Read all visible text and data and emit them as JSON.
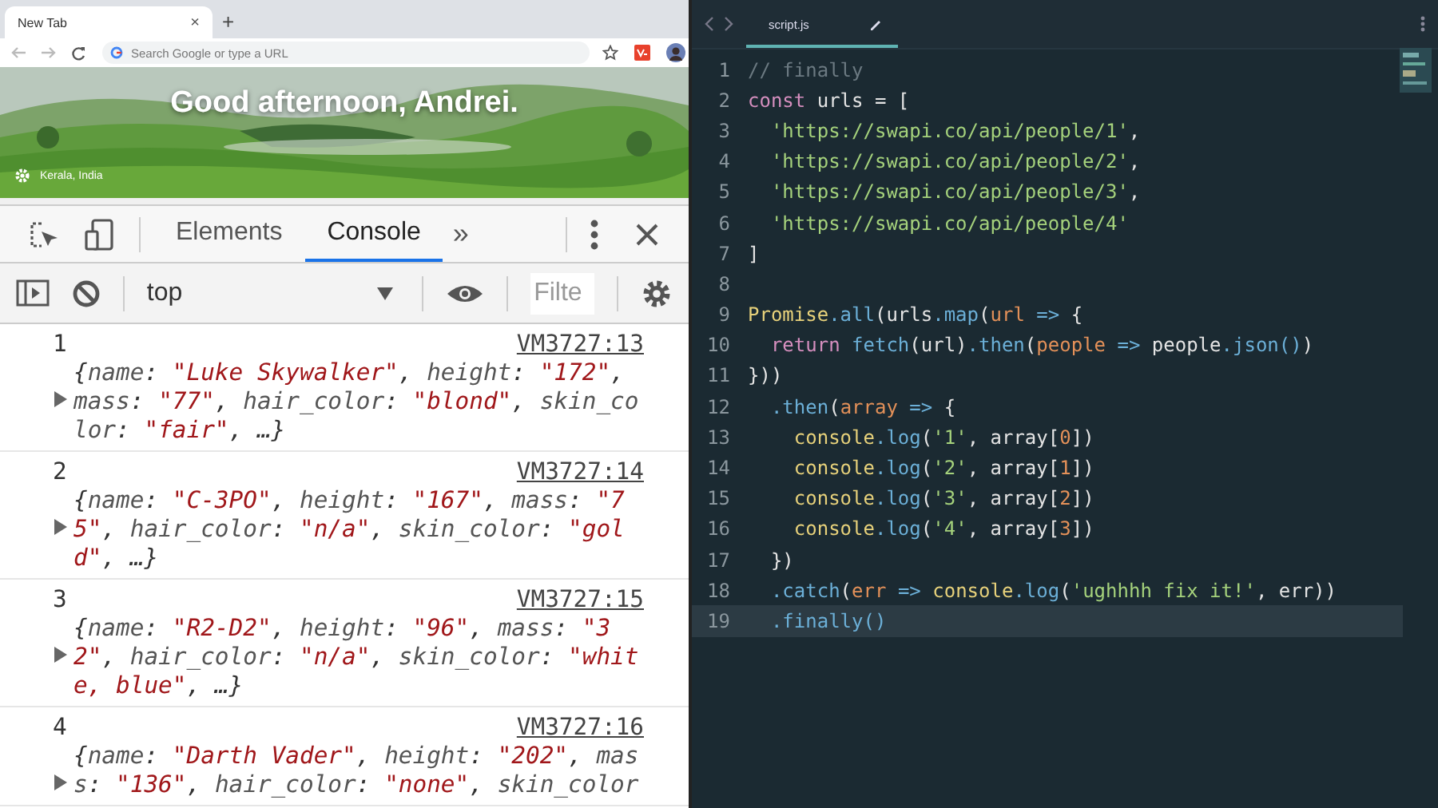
{
  "browser": {
    "tab_title": "New Tab",
    "tab_close": "×",
    "new_tab": "+",
    "address": {
      "placeholder": "Search Google or type a URL"
    },
    "greeting": "Good afternoon, Andrei.",
    "location": "Kerala, India"
  },
  "devtools": {
    "tabs": [
      {
        "label": "Elements",
        "selected": false
      },
      {
        "label": "Console",
        "selected": true
      }
    ],
    "more": "»",
    "context": "top",
    "filter": {
      "placeholder": "Filte"
    },
    "messages": [
      {
        "label": "1",
        "source": "VM3727:13",
        "tokens": [
          {
            "kind": "plain",
            "text": "{"
          },
          {
            "kind": "key",
            "text": "name"
          },
          {
            "kind": "plain",
            "text": ": "
          },
          {
            "kind": "string",
            "text": "\"Luke Skywalker\""
          },
          {
            "kind": "plain",
            "text": ", "
          },
          {
            "kind": "key",
            "text": "height"
          },
          {
            "kind": "plain",
            "text": ": "
          },
          {
            "kind": "string",
            "text": "\"172\""
          },
          {
            "kind": "plain",
            "text": ", "
          },
          {
            "kind": "key",
            "text": "mass"
          },
          {
            "kind": "plain",
            "text": ": "
          },
          {
            "kind": "string",
            "text": "\"77\""
          },
          {
            "kind": "plain",
            "text": ", "
          },
          {
            "kind": "key",
            "text": "hair_color"
          },
          {
            "kind": "plain",
            "text": ": "
          },
          {
            "kind": "string",
            "text": "\"blond\""
          },
          {
            "kind": "plain",
            "text": ", "
          },
          {
            "kind": "key",
            "text": "skin_color"
          },
          {
            "kind": "plain",
            "text": ": "
          },
          {
            "kind": "string",
            "text": "\"fair\""
          },
          {
            "kind": "plain",
            "text": ", …}"
          }
        ]
      },
      {
        "label": "2",
        "source": "VM3727:14",
        "tokens": [
          {
            "kind": "plain",
            "text": "{"
          },
          {
            "kind": "key",
            "text": "name"
          },
          {
            "kind": "plain",
            "text": ": "
          },
          {
            "kind": "string",
            "text": "\"C-3PO\""
          },
          {
            "kind": "plain",
            "text": ", "
          },
          {
            "kind": "key",
            "text": "height"
          },
          {
            "kind": "plain",
            "text": ": "
          },
          {
            "kind": "string",
            "text": "\"167\""
          },
          {
            "kind": "plain",
            "text": ", "
          },
          {
            "kind": "key",
            "text": "mass"
          },
          {
            "kind": "plain",
            "text": ": "
          },
          {
            "kind": "string",
            "text": "\"75\""
          },
          {
            "kind": "plain",
            "text": ", "
          },
          {
            "kind": "key",
            "text": "hair_color"
          },
          {
            "kind": "plain",
            "text": ": "
          },
          {
            "kind": "string",
            "text": "\"n/a\""
          },
          {
            "kind": "plain",
            "text": ", "
          },
          {
            "kind": "key",
            "text": "skin_color"
          },
          {
            "kind": "plain",
            "text": ": "
          },
          {
            "kind": "string",
            "text": "\"gold\""
          },
          {
            "kind": "plain",
            "text": ", …}"
          }
        ]
      },
      {
        "label": "3",
        "source": "VM3727:15",
        "tokens": [
          {
            "kind": "plain",
            "text": "{"
          },
          {
            "kind": "key",
            "text": "name"
          },
          {
            "kind": "plain",
            "text": ": "
          },
          {
            "kind": "string",
            "text": "\"R2-D2\""
          },
          {
            "kind": "plain",
            "text": ", "
          },
          {
            "kind": "key",
            "text": "height"
          },
          {
            "kind": "plain",
            "text": ": "
          },
          {
            "kind": "string",
            "text": "\"96\""
          },
          {
            "kind": "plain",
            "text": ", "
          },
          {
            "kind": "key",
            "text": "mass"
          },
          {
            "kind": "plain",
            "text": ": "
          },
          {
            "kind": "string",
            "text": "\"32\""
          },
          {
            "kind": "plain",
            "text": ", "
          },
          {
            "kind": "key",
            "text": "hair_color"
          },
          {
            "kind": "plain",
            "text": ": "
          },
          {
            "kind": "string",
            "text": "\"n/a\""
          },
          {
            "kind": "plain",
            "text": ", "
          },
          {
            "kind": "key",
            "text": "skin_color"
          },
          {
            "kind": "plain",
            "text": ": "
          },
          {
            "kind": "string",
            "text": "\"white, blue\""
          },
          {
            "kind": "plain",
            "text": ", …}"
          }
        ]
      },
      {
        "label": "4",
        "source": "VM3727:16",
        "tokens": [
          {
            "kind": "plain",
            "text": "{"
          },
          {
            "kind": "key",
            "text": "name"
          },
          {
            "kind": "plain",
            "text": ": "
          },
          {
            "kind": "string",
            "text": "\"Darth Vader\""
          },
          {
            "kind": "plain",
            "text": ", "
          },
          {
            "kind": "key",
            "text": "height"
          },
          {
            "kind": "plain",
            "text": ": "
          },
          {
            "kind": "string",
            "text": "\"202\""
          },
          {
            "kind": "plain",
            "text": ", "
          },
          {
            "kind": "key",
            "text": "mass"
          },
          {
            "kind": "plain",
            "text": ": "
          },
          {
            "kind": "string",
            "text": "\"136\""
          },
          {
            "kind": "plain",
            "text": ", "
          },
          {
            "kind": "key",
            "text": "hair_color"
          },
          {
            "kind": "plain",
            "text": ": "
          },
          {
            "kind": "string",
            "text": "\"none\""
          },
          {
            "kind": "plain",
            "text": ", "
          },
          {
            "kind": "key",
            "text": "skin_color"
          }
        ]
      }
    ]
  },
  "editor": {
    "file": "script.js",
    "lines": [
      {
        "number": "1",
        "highlighted": false,
        "tokens": [
          {
            "kind": "comment",
            "text": "// finally"
          }
        ]
      },
      {
        "number": "2",
        "highlighted": false,
        "tokens": [
          {
            "kind": "keyword",
            "text": "const"
          },
          {
            "kind": "plain",
            "text": " urls = ["
          }
        ]
      },
      {
        "number": "3",
        "highlighted": false,
        "tokens": [
          {
            "kind": "string",
            "text": "  'https://swapi.co/api/people/1'"
          },
          {
            "kind": "plain",
            "text": ","
          }
        ]
      },
      {
        "number": "4",
        "highlighted": false,
        "tokens": [
          {
            "kind": "string",
            "text": "  'https://swapi.co/api/people/2'"
          },
          {
            "kind": "plain",
            "text": ","
          }
        ]
      },
      {
        "number": "5",
        "highlighted": false,
        "tokens": [
          {
            "kind": "string",
            "text": "  'https://swapi.co/api/people/3'"
          },
          {
            "kind": "plain",
            "text": ","
          }
        ]
      },
      {
        "number": "6",
        "highlighted": false,
        "tokens": [
          {
            "kind": "string",
            "text": "  'https://swapi.co/api/people/4'"
          }
        ]
      },
      {
        "number": "7",
        "highlighted": false,
        "tokens": [
          {
            "kind": "plain",
            "text": "]"
          }
        ]
      },
      {
        "number": "8",
        "highlighted": false
      },
      {
        "number": "9",
        "highlighted": false,
        "tokens": [
          {
            "kind": "object",
            "text": "Promise"
          },
          {
            "kind": "func",
            "text": ".all"
          },
          {
            "kind": "plain",
            "text": "(urls"
          },
          {
            "kind": "func",
            "text": ".map"
          },
          {
            "kind": "plain",
            "text": "("
          },
          {
            "kind": "param",
            "text": "url"
          },
          {
            "kind": "func",
            "text": " =>"
          },
          {
            "kind": "plain",
            "text": " {"
          }
        ]
      },
      {
        "number": "10",
        "highlighted": false,
        "tokens": [
          {
            "kind": "keyword",
            "text": "  return"
          },
          {
            "kind": "func",
            "text": " fetch"
          },
          {
            "kind": "plain",
            "text": "(url)"
          },
          {
            "kind": "func",
            "text": ".then"
          },
          {
            "kind": "plain",
            "text": "("
          },
          {
            "kind": "param",
            "text": "people"
          },
          {
            "kind": "func",
            "text": " =>"
          },
          {
            "kind": "plain",
            "text": " people"
          },
          {
            "kind": "func",
            "text": ".json()"
          },
          {
            "kind": "plain",
            "text": ")"
          }
        ]
      },
      {
        "number": "11",
        "highlighted": false,
        "tokens": [
          {
            "kind": "plain",
            "text": "}))"
          }
        ]
      },
      {
        "number": "12",
        "highlighted": false,
        "tokens": [
          {
            "kind": "func",
            "text": "  .then"
          },
          {
            "kind": "plain",
            "text": "("
          },
          {
            "kind": "param",
            "text": "array"
          },
          {
            "kind": "func",
            "text": " =>"
          },
          {
            "kind": "plain",
            "text": " {"
          }
        ]
      },
      {
        "number": "13",
        "highlighted": false,
        "tokens": [
          {
            "kind": "object",
            "text": "    console"
          },
          {
            "kind": "func",
            "text": ".log"
          },
          {
            "kind": "plain",
            "text": "("
          },
          {
            "kind": "string",
            "text": "'1'"
          },
          {
            "kind": "plain",
            "text": ", array["
          },
          {
            "kind": "number",
            "text": "0"
          },
          {
            "kind": "plain",
            "text": "])"
          }
        ]
      },
      {
        "number": "14",
        "highlighted": false,
        "tokens": [
          {
            "kind": "object",
            "text": "    console"
          },
          {
            "kind": "func",
            "text": ".log"
          },
          {
            "kind": "plain",
            "text": "("
          },
          {
            "kind": "string",
            "text": "'2'"
          },
          {
            "kind": "plain",
            "text": ", array["
          },
          {
            "kind": "number",
            "text": "1"
          },
          {
            "kind": "plain",
            "text": "])"
          }
        ]
      },
      {
        "number": "15",
        "highlighted": false,
        "tokens": [
          {
            "kind": "object",
            "text": "    console"
          },
          {
            "kind": "func",
            "text": ".log"
          },
          {
            "kind": "plain",
            "text": "("
          },
          {
            "kind": "string",
            "text": "'3'"
          },
          {
            "kind": "plain",
            "text": ", array["
          },
          {
            "kind": "number",
            "text": "2"
          },
          {
            "kind": "plain",
            "text": "])"
          }
        ]
      },
      {
        "number": "16",
        "highlighted": false,
        "tokens": [
          {
            "kind": "object",
            "text": "    console"
          },
          {
            "kind": "func",
            "text": ".log"
          },
          {
            "kind": "plain",
            "text": "("
          },
          {
            "kind": "string",
            "text": "'4'"
          },
          {
            "kind": "plain",
            "text": ", array["
          },
          {
            "kind": "number",
            "text": "3"
          },
          {
            "kind": "plain",
            "text": "])"
          }
        ]
      },
      {
        "number": "17",
        "highlighted": false,
        "tokens": [
          {
            "kind": "plain",
            "text": "  })"
          }
        ]
      },
      {
        "number": "18",
        "highlighted": false,
        "tokens": [
          {
            "kind": "func",
            "text": "  .catch"
          },
          {
            "kind": "plain",
            "text": "("
          },
          {
            "kind": "param",
            "text": "err"
          },
          {
            "kind": "func",
            "text": " => "
          },
          {
            "kind": "object",
            "text": "console"
          },
          {
            "kind": "func",
            "text": ".log"
          },
          {
            "kind": "plain",
            "text": "("
          },
          {
            "kind": "string",
            "text": "'ughhhh fix it!'"
          },
          {
            "kind": "plain",
            "text": ", err))"
          }
        ]
      },
      {
        "number": "19",
        "highlighted": true,
        "tokens": [
          {
            "kind": "func",
            "text": "  .finally()"
          }
        ]
      }
    ]
  }
}
